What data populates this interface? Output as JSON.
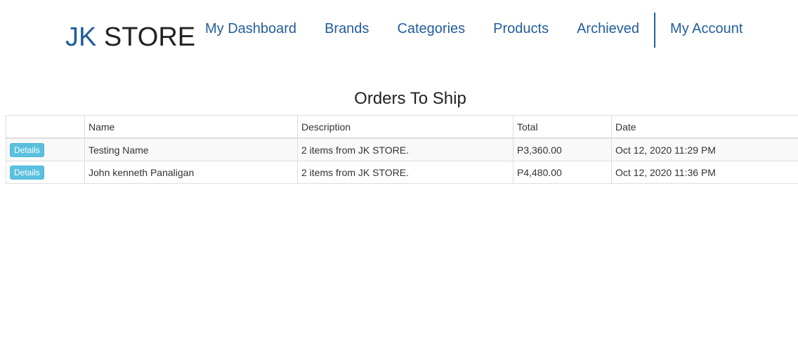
{
  "brand": {
    "part1": "JK",
    "part2": "STORE"
  },
  "nav": {
    "items": [
      "My Dashboard",
      "Brands",
      "Categories",
      "Products",
      "Archieved"
    ],
    "account": "My Account"
  },
  "page_title": "Orders To Ship",
  "table": {
    "columns": [
      "",
      "Name",
      "Description",
      "Total",
      "Date"
    ],
    "rows": [
      {
        "action": "Details",
        "name": "Testing Name",
        "description": "2 items from JK STORE.",
        "total": "P3,360.00",
        "date": "Oct 12, 2020 11:29 PM"
      },
      {
        "action": "Details",
        "name": "John kenneth Panaligan",
        "description": "2 items from JK STORE.",
        "total": "P4,480.00",
        "date": "Oct 12, 2020 11:36 PM"
      }
    ]
  },
  "colors": {
    "brand_blue": "#225e9b",
    "button_info": "#5bc0de"
  }
}
